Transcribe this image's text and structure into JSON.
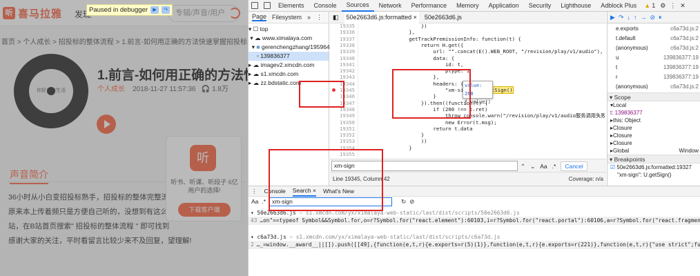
{
  "page": {
    "logo_text": "喜马拉雅",
    "logo_mark": "听",
    "nav_partial": "发现",
    "search_placeholder": "专辑/声音/用户",
    "breadcrumb": "首页 > 个人成长 > 招投标的整体流程 > 1.前言-如何用正确的方法快速掌握招投标",
    "title": "1.前言-如何用正确的方法快",
    "category": "个人成长",
    "date": "2018-11-27 11:57:36",
    "plays": "1.8万",
    "cover_text": "你好工作生活",
    "section_title": "声音简介",
    "intro_lines": [
      "36小时从小白变招投标熟手，招投标的整体完整流",
      "原来本上传着频只是方便自己听的，没想到有这么",
      "站，在B站首页搜索\" 招投标的整体流程 \" 即可找到",
      "感谢大家的关注，平时看留言比较少来不及回复，望理解!"
    ],
    "popup_icon": "听",
    "popup_text": "听书、听课、听段子 6亿用户的选择!",
    "popup_button": "下载客户端",
    "paused_label": "Paused in debugger"
  },
  "devtools": {
    "tabs": [
      "Elements",
      "Console",
      "Sources",
      "Network",
      "Performance",
      "Memory",
      "Application",
      "Security",
      "Lighthouse",
      "Adblock Plus"
    ],
    "active_tab": "Sources",
    "warning_count": "1",
    "nav_tabs": [
      "Page",
      "Filesystem"
    ],
    "tree": [
      "top",
      "www.ximalaya.com",
      "gerenchengzhang/19596428",
      "139836377",
      "imagev2.xmcdn.com",
      "s1.xmcdn.com",
      "zz.bdstatic.com"
    ],
    "editor_tabs": [
      "50e2663d6.js:formatted",
      "50e2663d6.js"
    ],
    "code_lines": [
      {
        "n": "19335",
        "t": "                    })"
      },
      {
        "n": "19336",
        "t": "                },"
      },
      {
        "n": "19337",
        "t": "                getTrackPremissionInfo: function(t) {"
      },
      {
        "n": "19338",
        "t": "                    return H.get({"
      },
      {
        "n": "19339",
        "t": "                        url: \"\".concat(E().WEB_ROOT, \"/revision/play/v1/audio\"),"
      },
      {
        "n": "19340",
        "t": "                        data: {"
      },
      {
        "n": "19341",
        "t": "                            id: t,"
      },
      {
        "n": "19342",
        "t": "                            ptype: 1"
      },
      {
        "n": "19343",
        "t": "                        },"
      },
      {
        "n": "19344",
        "t": "                        headers: {"
      },
      {
        "n": "19345",
        "t": "                            \"xm-sign\": U.getSign()"
      },
      {
        "n": "19346",
        "t": "                        }"
      },
      {
        "n": "19347",
        "t": "                    }).then((function(t) {"
      },
      {
        "n": "19348",
        "t": "                        if (200 !== t.ret)"
      },
      {
        "n": "19349",
        "t": "                            throw console.warn(\"/revision/play/v1/audio服务调用失败: \""
      },
      {
        "n": "19350",
        "t": "                            new Error(t.msg);"
      },
      {
        "n": "19351",
        "t": "                        return t.data"
      },
      {
        "n": "19352",
        "t": "                    }"
      },
      {
        "n": "19353",
        "t": "                    ))"
      },
      {
        "n": "19354",
        "t": "                }"
      },
      {
        "n": "19355",
        "t": ""
      }
    ],
    "tooltip_lines": [
      "value: 268",
      "ƒ value()"
    ],
    "find_value": "xm-sign",
    "find_case": "Aa",
    "find_regex": ".*",
    "cancel_label": "Cancel",
    "status_left": "Line 19345, Column 42",
    "status_right": "Coverage: n/a",
    "call_stack": [
      {
        "fn": "e.exports",
        "loc": "c6a73d.js:2"
      },
      {
        "fn": "t.default",
        "loc": "c6a73d.js:2"
      },
      {
        "fn": "(anonymous)",
        "loc": "c6a73d.js:2"
      },
      {
        "fn": "u",
        "loc": "139836377:19"
      },
      {
        "fn": "t",
        "loc": "139836377:19"
      },
      {
        "fn": "r",
        "loc": "139836377:19"
      },
      {
        "fn": "(anonymous)",
        "loc": "c6a73d.js:2"
      }
    ],
    "scope_header": "Scope",
    "scope_lines": [
      "▾Local",
      "  t: 139836377",
      "  ▸this: Object",
      "▸Closure",
      "▸Closure",
      "▸Closure",
      "▸Global"
    ],
    "scope_global_value": "Window",
    "breakpoints_header": "Breakpoints",
    "breakpoint_file": "50e2663d6.js:formatted:19327",
    "breakpoint_code": "\"xm-sign\": U.getSign()",
    "drawer_tabs": [
      "Console",
      "Search",
      "What's New"
    ],
    "search_value": "xm-sign",
    "search_case": "Aa",
    "search_regex": ".*",
    "results": [
      {
        "file": "50e2663d6.js",
        "path": "— s1.xmcdn.com/yx/ximalaya-web-static/last/dist/scripts/50e2663d6.js"
      },
      {
        "file": "c6a73d.js",
        "path": "— s1.xmcdn.com/yx/ximalaya-web-static/last/dist/scripts/c6a73d.js"
      }
    ],
    "result_lines": [
      {
        "n": "43",
        "t": "…on\"==typeof Symbol&&Symbol.for,o=r?Symbol.for(\"react.element\"):60103,i=r?Symbol.for(\"react.portal\"):60106,a=r?Symbol.for(\"react.fragment\"):60107,u=r?Symbol.for(\"react.strict_mod"
      },
      {
        "n": "2",
        "t": "…_=window.__award__||[]).push([[49],{function(e,t,r){e.exports=r(5)(1)},function(e,t,r){e.exports=r(221)},function(e,t,r){\"use strict\";function n(e){return(n=\"function\"==typeof Symbol&&\"symb"
      }
    ]
  }
}
